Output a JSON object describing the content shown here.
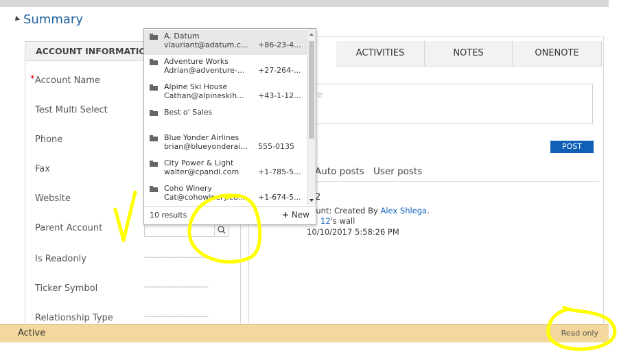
{
  "summary": {
    "title": "Summary"
  },
  "account_panel": {
    "header": "ACCOUNT INFORMATION",
    "fields": [
      {
        "label": "Account Name",
        "required": true
      },
      {
        "label": "Test Multi Select"
      },
      {
        "label": "Phone"
      },
      {
        "label": "Fax"
      },
      {
        "label": "Website"
      },
      {
        "label": "Parent Account"
      },
      {
        "label": "Is Readonly",
        "value": "--------------------------"
      },
      {
        "label": "Ticker Symbol",
        "value": "--------------------------"
      },
      {
        "label": "Relationship Type",
        "value": "--------------------------"
      }
    ]
  },
  "tabs": [
    {
      "label": "ACTIVITIES"
    },
    {
      "label": "NOTES"
    },
    {
      "label": "ONENOTE"
    }
  ],
  "post": {
    "placeholder_fragment": "re",
    "post_button": "POST",
    "filter_auto": "Auto posts",
    "filter_user": "User posts",
    "entry_marker": "2",
    "entry_prefix": "count: Created By ",
    "entry_author": "Alex Shlega",
    "entry_author_suffix": ".",
    "entry_wall_link": "12",
    "entry_wall_suffix": "'s wall",
    "entry_time": "10/10/2017 5:58:26 PM"
  },
  "lookup": {
    "results": [
      {
        "name": "A. Datum",
        "email": "vlauriant@adatum.c...",
        "phone": "+86-23-4..."
      },
      {
        "name": "Adventure Works",
        "email": "Adrian@adventure-...",
        "phone": "+27-264-..."
      },
      {
        "name": "Alpine Ski House",
        "email": "Cathan@alpineskih...",
        "phone": "+43-1-12..."
      },
      {
        "name": "Best o' Sales",
        "email": "",
        "phone": ""
      },
      {
        "name": "Blue Yonder Airlines",
        "email": "brian@blueyonderai...",
        "phone": "555-0135"
      },
      {
        "name": "City Power & Light",
        "email": "walter@cpandl.com",
        "phone": "+1-785-5..."
      },
      {
        "name": "Coho Winery",
        "email": "Cat@cohowinery.co...",
        "phone": "+1-674-5..."
      }
    ],
    "count_text": "10 results",
    "new_label": "New",
    "new_icon": "+"
  },
  "status": {
    "state": "Active",
    "mode": "Read only"
  },
  "colors": {
    "accent_blue": "#1160b7",
    "status_bar": "#f3d79c",
    "annotation_yellow": "#ffff00"
  },
  "icons": {
    "collapse": "chevron-down-icon",
    "search": "search-icon",
    "account": "account-icon",
    "checkmark_annotation": "checkmark-icon"
  }
}
